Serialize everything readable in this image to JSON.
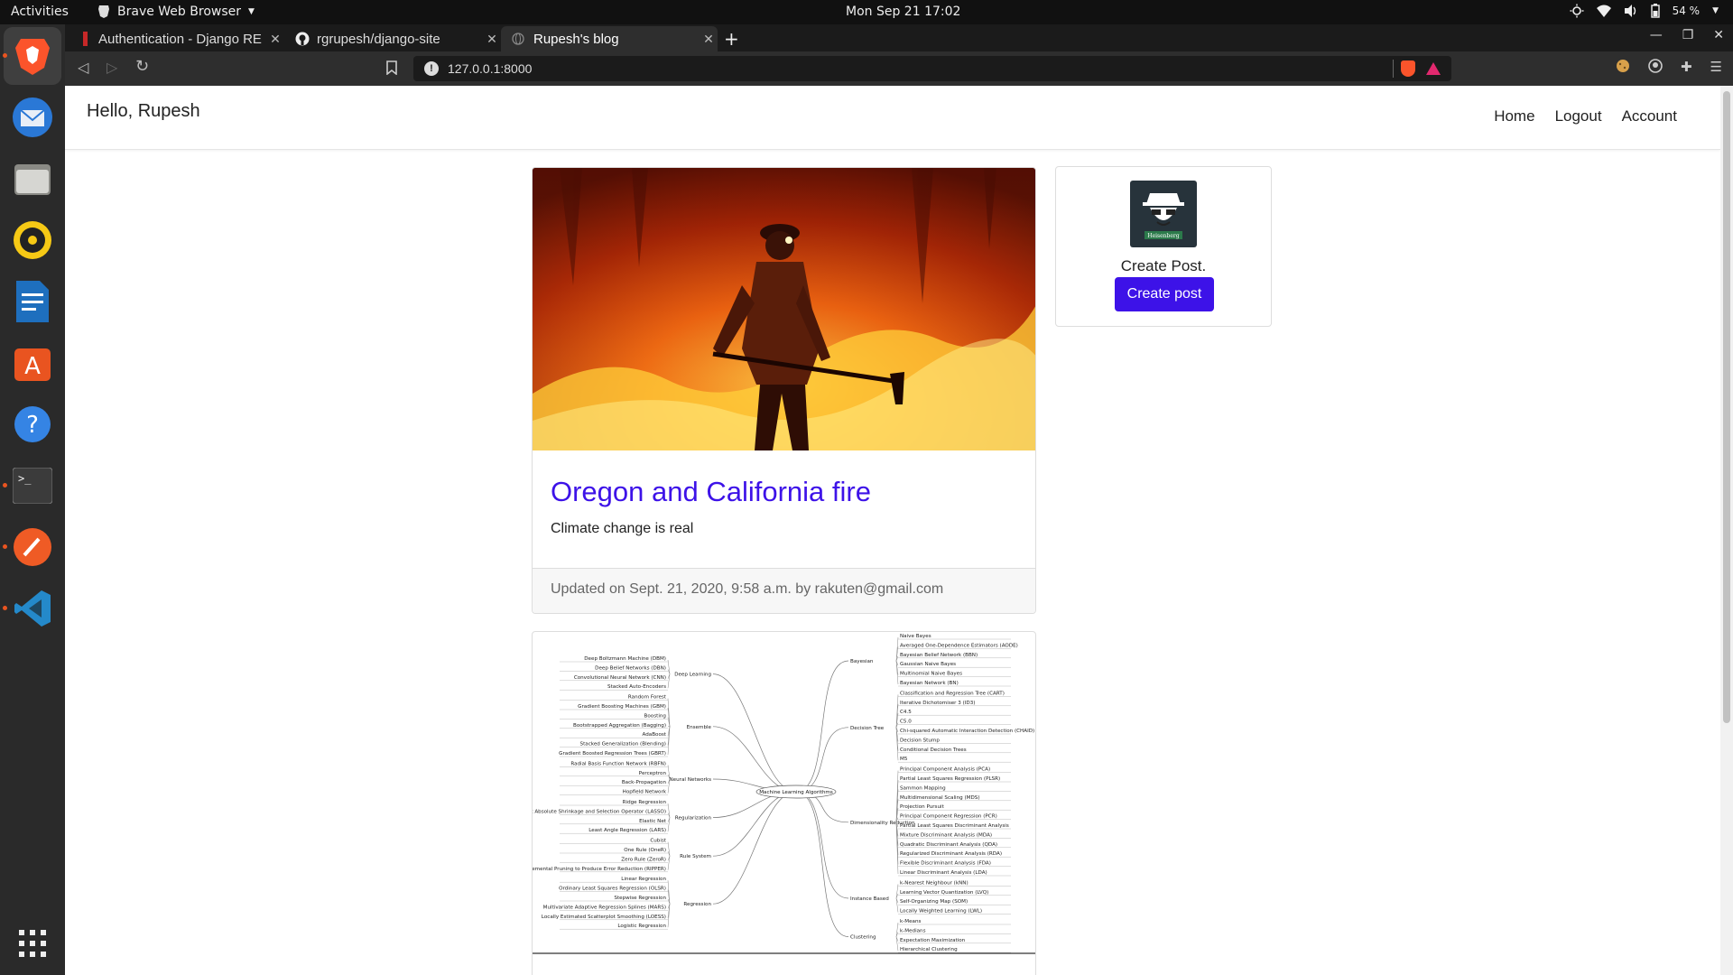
{
  "system": {
    "activities": "Activities",
    "app_name": "Brave Web Browser",
    "clock": "Mon Sep 21  17:02",
    "battery": "54 %"
  },
  "browser": {
    "tabs": [
      {
        "title": "Authentication - Django RE"
      },
      {
        "title": "rgrupesh/django-site"
      },
      {
        "title": "Rupesh's blog"
      }
    ],
    "url": "127.0.0.1:8000"
  },
  "page": {
    "greeting": "Hello, Rupesh",
    "nav": {
      "home": "Home",
      "logout": "Logout",
      "account": "Account"
    },
    "post": {
      "title": "Oregon and California fire",
      "text": "Climate change is real",
      "footer": "Updated on Sept. 21, 2020, 9:58 a.m. by rakuten@gmail.com"
    },
    "sidebar": {
      "caption": "Create Post.",
      "button": "Create post",
      "avatar_text": "Heisenberg"
    },
    "mindmap": {
      "center": "Machine Learning Algorithms",
      "left": [
        {
          "name": "Deep Learning",
          "items": [
            "Deep Boltzmann Machine (DBM)",
            "Deep Belief Networks (DBN)",
            "Convolutional Neural Network (CNN)",
            "Stacked Auto-Encoders"
          ]
        },
        {
          "name": "Ensemble",
          "items": [
            "Random Forest",
            "Gradient Boosting Machines (GBM)",
            "Boosting",
            "Bootstrapped Aggregation (Bagging)",
            "AdaBoost",
            "Stacked Generalization (Blending)",
            "Gradient Boosted Regression Trees (GBRT)"
          ]
        },
        {
          "name": "Neural Networks",
          "items": [
            "Radial Basis Function Network (RBFN)",
            "Perceptron",
            "Back-Propagation",
            "Hopfield Network"
          ]
        },
        {
          "name": "Regularization",
          "items": [
            "Ridge Regression",
            "Least Absolute Shrinkage and Selection Operator (LASSO)",
            "Elastic Net",
            "Least Angle Regression (LARS)"
          ]
        },
        {
          "name": "Rule System",
          "items": [
            "Cubist",
            "One Rule (OneR)",
            "Zero Rule (ZeroR)",
            "Repeated Incremental Pruning to Produce Error Reduction (RIPPER)"
          ]
        },
        {
          "name": "Regression",
          "items": [
            "Linear Regression",
            "Ordinary Least Squares Regression (OLSR)",
            "Stepwise Regression",
            "Multivariate Adaptive Regression Splines (MARS)",
            "Locally Estimated Scatterplot Smoothing (LOESS)",
            "Logistic Regression"
          ]
        }
      ],
      "right": [
        {
          "name": "Bayesian",
          "items": [
            "Naive Bayes",
            "Averaged One-Dependence Estimators (AODE)",
            "Bayesian Belief Network (BBN)",
            "Gaussian Naive Bayes",
            "Multinomial Naive Bayes",
            "Bayesian Network (BN)"
          ]
        },
        {
          "name": "Decision Tree",
          "items": [
            "Classification and Regression Tree (CART)",
            "Iterative Dichotomiser 3 (ID3)",
            "C4.5",
            "C5.0",
            "Chi-squared Automatic Interaction Detection (CHAID)",
            "Decision Stump",
            "Conditional Decision Trees",
            "M5"
          ]
        },
        {
          "name": "Dimensionality Reduction",
          "items": [
            "Principal Component Analysis (PCA)",
            "Partial Least Squares Regression (PLSR)",
            "Sammon Mapping",
            "Multidimensional Scaling (MDS)",
            "Projection Pursuit",
            "Principal Component Regression (PCR)",
            "Partial Least Squares Discriminant Analysis",
            "Mixture Discriminant Analysis (MDA)",
            "Quadratic Discriminant Analysis (QDA)",
            "Regularized Discriminant Analysis (RDA)",
            "Flexible Discriminant Analysis (FDA)",
            "Linear Discriminant Analysis (LDA)"
          ]
        },
        {
          "name": "Instance Based",
          "items": [
            "k-Nearest Neighbour (kNN)",
            "Learning Vector Quantization (LVQ)",
            "Self-Organizing Map (SOM)",
            "Locally Weighted Learning (LWL)"
          ]
        },
        {
          "name": "Clustering",
          "items": [
            "k-Means",
            "k-Medians",
            "Expectation Maximization",
            "Hierarchical Clustering"
          ]
        }
      ]
    }
  }
}
